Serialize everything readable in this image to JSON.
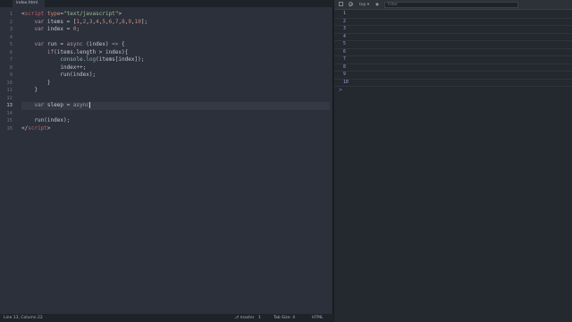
{
  "editor": {
    "tab_title": "index.html",
    "active_line": 13,
    "line_numbers": [
      "1",
      "2",
      "3",
      "4",
      "5",
      "6",
      "7",
      "8",
      "9",
      "10",
      "11",
      "12",
      "13",
      "14",
      "15",
      "16"
    ],
    "code_lines": [
      [
        {
          "t": "<",
          "c": "t-plain"
        },
        {
          "t": "script",
          "c": "t-tag"
        },
        {
          "t": " ",
          "c": "t-plain"
        },
        {
          "t": "type",
          "c": "t-attr"
        },
        {
          "t": "=",
          "c": "t-plain"
        },
        {
          "t": "\"text/javascript\"",
          "c": "t-str"
        },
        {
          "t": ">",
          "c": "t-plain"
        }
      ],
      [
        {
          "t": "    ",
          "c": "t-plain"
        },
        {
          "t": "var",
          "c": "t-kw"
        },
        {
          "t": " items = [",
          "c": "t-plain"
        },
        {
          "t": "1",
          "c": "t-num"
        },
        {
          "t": ",",
          "c": "t-plain"
        },
        {
          "t": "2",
          "c": "t-num"
        },
        {
          "t": ",",
          "c": "t-plain"
        },
        {
          "t": "3",
          "c": "t-num"
        },
        {
          "t": ",",
          "c": "t-plain"
        },
        {
          "t": "4",
          "c": "t-num"
        },
        {
          "t": ",",
          "c": "t-plain"
        },
        {
          "t": "5",
          "c": "t-num"
        },
        {
          "t": ",",
          "c": "t-plain"
        },
        {
          "t": "6",
          "c": "t-num"
        },
        {
          "t": ",",
          "c": "t-plain"
        },
        {
          "t": "7",
          "c": "t-num"
        },
        {
          "t": ",",
          "c": "t-plain"
        },
        {
          "t": "8",
          "c": "t-num"
        },
        {
          "t": ",",
          "c": "t-plain"
        },
        {
          "t": "9",
          "c": "t-num"
        },
        {
          "t": ",",
          "c": "t-plain"
        },
        {
          "t": "10",
          "c": "t-num"
        },
        {
          "t": "];",
          "c": "t-plain"
        }
      ],
      [
        {
          "t": "    ",
          "c": "t-plain"
        },
        {
          "t": "var",
          "c": "t-kw"
        },
        {
          "t": " index = ",
          "c": "t-plain"
        },
        {
          "t": "0",
          "c": "t-num"
        },
        {
          "t": ";",
          "c": "t-plain"
        }
      ],
      [
        {
          "t": "",
          "c": "t-plain"
        }
      ],
      [
        {
          "t": "    ",
          "c": "t-plain"
        },
        {
          "t": "var",
          "c": "t-kw"
        },
        {
          "t": " run = ",
          "c": "t-plain"
        },
        {
          "t": "async",
          "c": "t-kw"
        },
        {
          "t": " (index) ",
          "c": "t-plain"
        },
        {
          "t": "=>",
          "c": "t-kw"
        },
        {
          "t": " {",
          "c": "t-plain"
        }
      ],
      [
        {
          "t": "        ",
          "c": "t-plain"
        },
        {
          "t": "if",
          "c": "t-kw"
        },
        {
          "t": "(items.length > index){",
          "c": "t-plain"
        }
      ],
      [
        {
          "t": "            ",
          "c": "t-plain"
        },
        {
          "t": "console",
          "c": "t-op"
        },
        {
          "t": ".",
          "c": "t-plain"
        },
        {
          "t": "log",
          "c": "t-fn"
        },
        {
          "t": "(items[index]);",
          "c": "t-plain"
        }
      ],
      [
        {
          "t": "            index++;",
          "c": "t-plain"
        }
      ],
      [
        {
          "t": "            run(index);",
          "c": "t-plain"
        }
      ],
      [
        {
          "t": "        }",
          "c": "t-plain"
        }
      ],
      [
        {
          "t": "    }",
          "c": "t-plain"
        }
      ],
      [
        {
          "t": "",
          "c": "t-plain"
        }
      ],
      [
        {
          "t": "    ",
          "c": "t-plain"
        },
        {
          "t": "var",
          "c": "t-kw"
        },
        {
          "t": " sleep = ",
          "c": "t-plain"
        },
        {
          "t": "async",
          "c": "t-kw"
        }
      ],
      [
        {
          "t": "",
          "c": "t-plain"
        }
      ],
      [
        {
          "t": "    run(index);",
          "c": "t-plain"
        }
      ],
      [
        {
          "t": "</",
          "c": "t-plain"
        },
        {
          "t": "script",
          "c": "t-tag"
        },
        {
          "t": ">",
          "c": "t-plain"
        }
      ]
    ]
  },
  "statusbar": {
    "position": "Line 13, Column 22",
    "branch": "master",
    "branch_count": "1",
    "tab_size": "Tab Size: 4",
    "syntax": "HTML"
  },
  "console": {
    "context": "top",
    "filter_placeholder": "Filter",
    "logs": [
      "1",
      "2",
      "3",
      "4",
      "5",
      "6",
      "7",
      "8",
      "9",
      "10"
    ],
    "prompt": ">"
  },
  "colors": {
    "editor_bg": "#2b303b",
    "console_bg": "#24282f",
    "keyword": "#b48ead",
    "string": "#a3be8c",
    "number": "#d08770",
    "tag": "#bf616a"
  }
}
